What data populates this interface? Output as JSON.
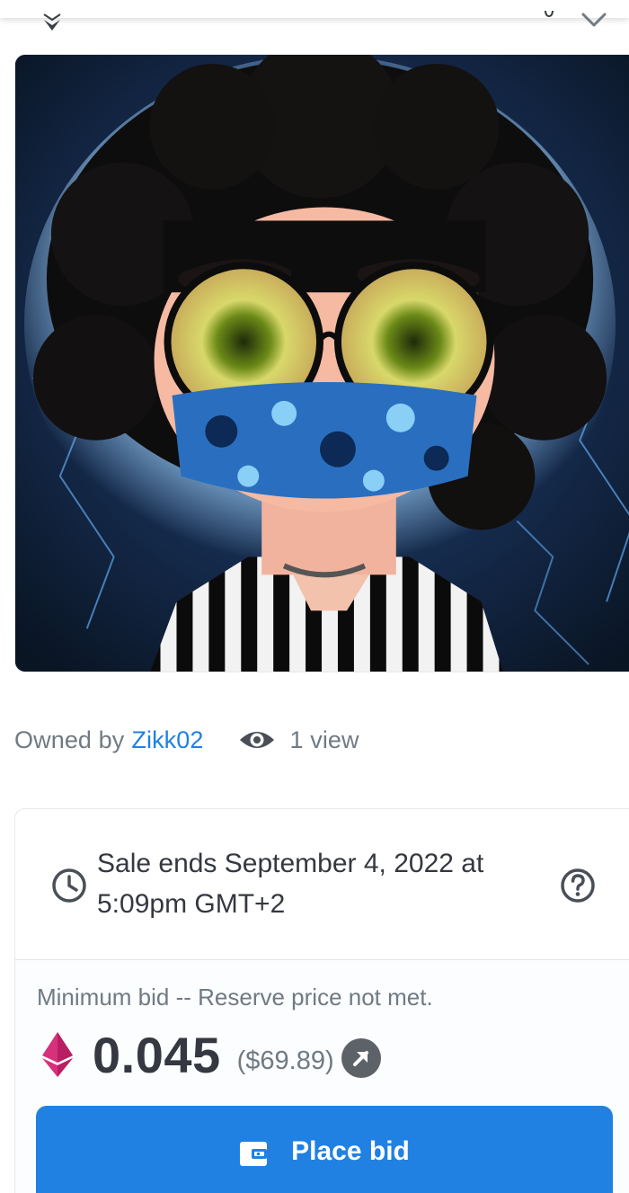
{
  "owner": {
    "prefix": "Owned by",
    "name": "Zikk02",
    "views": "1 view"
  },
  "sale": {
    "ends_text": "Sale ends September 4, 2022 at 5:09pm GMT+2",
    "min_bid_label": "Minimum bid -- Reserve price not met.",
    "price": "0.045",
    "price_usd": "($69.89)",
    "button_label": "Place bid"
  },
  "icons": {
    "currency": "ethereum-icon",
    "clock": "clock-icon",
    "help": "question-icon",
    "views": "eye-icon",
    "external": "arrow-up-right-icon",
    "wallet": "wallet-icon"
  },
  "colors": {
    "accent": "#2081e2",
    "text_primary": "#353840",
    "text_secondary": "#707a83",
    "eth": "#d6317a"
  }
}
